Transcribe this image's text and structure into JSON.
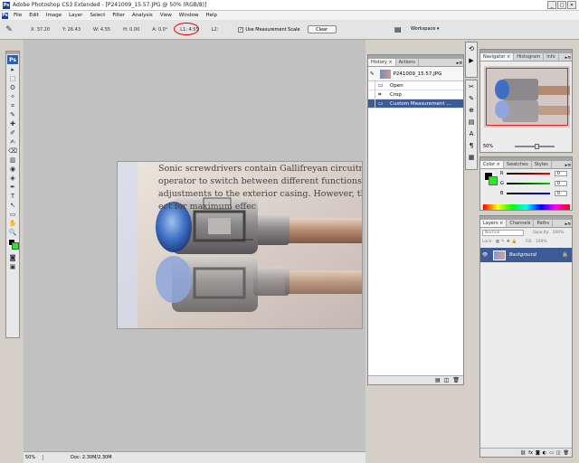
{
  "window": {
    "app_icon": "Ps",
    "title": "Adobe Photoshop CS3 Extended - [P241009_15.57.JPG @ 50% (RGB/8)]",
    "min": "_",
    "max": "□",
    "close": "✕"
  },
  "menu": {
    "items": [
      "File",
      "Edit",
      "Image",
      "Layer",
      "Select",
      "Filter",
      "Analysis",
      "View",
      "Window",
      "Help"
    ]
  },
  "options": {
    "x": "X: 37.20",
    "y": "Y: 26.43",
    "w": "W: 4.55",
    "h": "H: 0.00",
    "angle": "A: 0.0°",
    "l1": "L1: 4.55",
    "l2": "L2:",
    "use_scale_label": "Use Measurement Scale",
    "clear_label": "Clear",
    "workspace_label": "Workspace ▾"
  },
  "toolbox": {
    "logo": "Ps",
    "tools": [
      "▸",
      "⬚",
      "ʘ",
      "✧",
      "⌗",
      "✎",
      "✚",
      "✐",
      "✍",
      "⌫",
      "▥",
      "◉",
      "◈",
      "✒",
      "T",
      "↖",
      "▭",
      "✋",
      "🔍"
    ]
  },
  "document": {
    "lines": [
      "Sonic screwdrivers contain Gallifreyan circuitry,",
      "operator to switch between different functions u",
      "adjustments to the exterior casing. However, the",
      "                                 ect for maximum effec"
    ]
  },
  "status": {
    "zoom": "50%",
    "doc": "Doc: 2.30M/2.30M"
  },
  "history": {
    "tabs": [
      "History ×",
      "Actions"
    ],
    "snapshot_name": "P241009_15.57.JPG",
    "states": [
      {
        "name": "Open",
        "selected": false
      },
      {
        "name": "Crop",
        "selected": false
      },
      {
        "name": "Custom Measurement ...",
        "selected": true
      }
    ]
  },
  "navigator": {
    "tabs": [
      "Navigator ×",
      "Histogram",
      "Info"
    ],
    "zoom": "50%"
  },
  "color": {
    "tabs": [
      "Color ×",
      "Swatches",
      "Styles"
    ],
    "r_label": "R",
    "g_label": "G",
    "b_label": "B",
    "r_value": "0",
    "g_value": "0",
    "b_value": "0",
    "fg_color": "#000000",
    "bg_color": "#22ee22"
  },
  "layers": {
    "tabs": [
      "Layers ×",
      "Channels",
      "Paths"
    ],
    "blend_mode": "Normal",
    "opacity_label": "Opacity:",
    "opacity": "100%",
    "lock_label": "Lock:",
    "fill_label": "Fill:",
    "fill": "100%",
    "layer_name": "Background"
  }
}
